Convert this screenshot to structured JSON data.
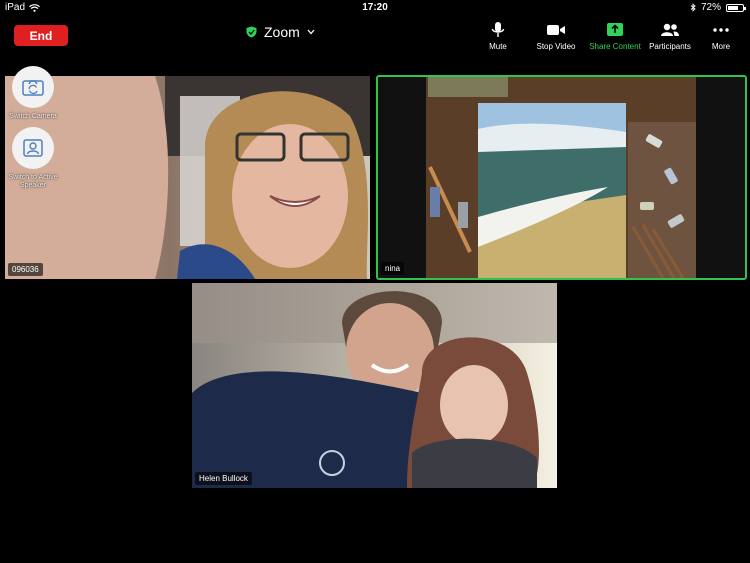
{
  "status_bar": {
    "device": "iPad",
    "time": "17:20",
    "battery_percent": "72%",
    "battery_level": 0.72
  },
  "toolbar": {
    "end_label": "End",
    "meeting_title": "Zoom",
    "tools": [
      {
        "label": "Mute",
        "icon": "microphone-icon"
      },
      {
        "label": "Stop Video",
        "icon": "video-camera-icon"
      },
      {
        "label": "Share Content",
        "icon": "share-screen-icon"
      },
      {
        "label": "Participants",
        "icon": "participants-icon"
      },
      {
        "label": "More",
        "icon": "more-icon"
      }
    ]
  },
  "floating_controls": {
    "switch_camera": "Switch Camera",
    "switch_speaker": "Switch to Active Speaker"
  },
  "participants": [
    {
      "name": "096036"
    },
    {
      "name": "nina",
      "active_speaker": true
    },
    {
      "name": "Helen Bullock"
    }
  ],
  "colors": {
    "end_button": "#e02020",
    "share_accent": "#2fd35a",
    "active_border": "#32c24d",
    "shield": "#2fd35a"
  }
}
